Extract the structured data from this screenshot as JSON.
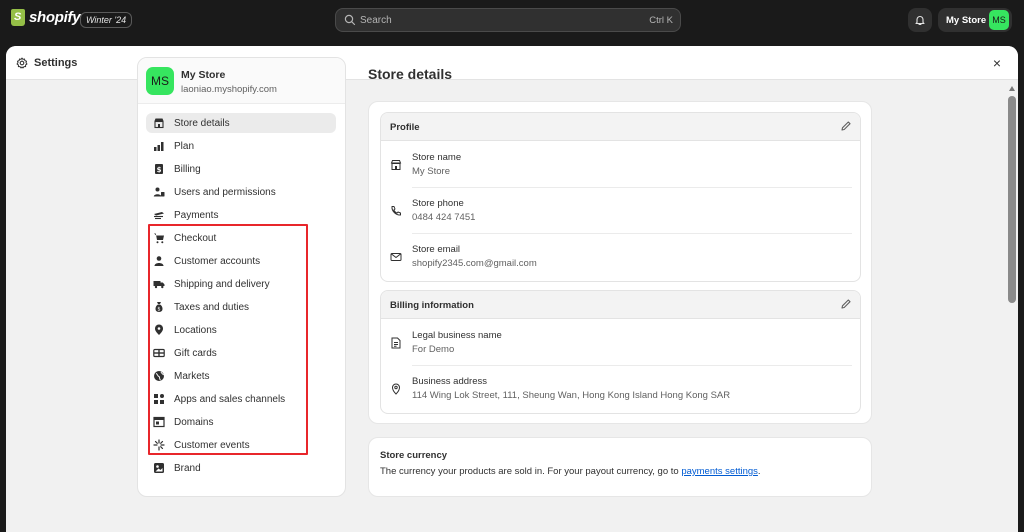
{
  "topbar": {
    "logo_text": "shopify",
    "edition": "Winter '24",
    "search_placeholder": "Search",
    "search_shortcut": "Ctrl K",
    "store_button": "My Store",
    "store_initials": "MS"
  },
  "modal": {
    "title": "Settings",
    "close": "×"
  },
  "sidebar": {
    "store_initials": "MS",
    "store_name": "My Store",
    "store_domain": "laoniao.myshopify.com",
    "items": [
      {
        "label": "Store details",
        "icon": "store-icon",
        "active": true
      },
      {
        "label": "Plan",
        "icon": "plan-icon"
      },
      {
        "label": "Billing",
        "icon": "billing-icon"
      },
      {
        "label": "Users and permissions",
        "icon": "users-icon"
      },
      {
        "label": "Payments",
        "icon": "payments-icon"
      },
      {
        "label": "Checkout",
        "icon": "cart-icon"
      },
      {
        "label": "Customer accounts",
        "icon": "person-icon"
      },
      {
        "label": "Shipping and delivery",
        "icon": "truck-icon"
      },
      {
        "label": "Taxes and duties",
        "icon": "money-bag-icon"
      },
      {
        "label": "Locations",
        "icon": "location-pin-icon"
      },
      {
        "label": "Gift cards",
        "icon": "gift-card-icon"
      },
      {
        "label": "Markets",
        "icon": "globe-icon"
      },
      {
        "label": "Apps and sales channels",
        "icon": "apps-icon"
      },
      {
        "label": "Domains",
        "icon": "domains-icon"
      },
      {
        "label": "Customer events",
        "icon": "sparkle-icon"
      },
      {
        "label": "Brand",
        "icon": "brand-icon"
      }
    ]
  },
  "main": {
    "title": "Store details",
    "profile": {
      "title": "Profile",
      "rows": [
        {
          "label": "Store name",
          "value": "My Store",
          "icon": "store-icon"
        },
        {
          "label": "Store phone",
          "value": "0484 424 7451",
          "icon": "phone-icon"
        },
        {
          "label": "Store email",
          "value": "shopify2345.com@gmail.com",
          "icon": "email-icon"
        }
      ]
    },
    "billing": {
      "title": "Billing information",
      "rows": [
        {
          "label": "Legal business name",
          "value": "For Demo",
          "icon": "document-icon"
        },
        {
          "label": "Business address",
          "value": "114 Wing Lok Street, 111, Sheung Wan, Hong Kong Island Hong Kong SAR",
          "icon": "location-pin-icon"
        }
      ]
    },
    "currency": {
      "title": "Store currency",
      "description": "The currency your products are sold in. For your payout currency, go to",
      "link": "payments settings",
      "suffix": "."
    }
  },
  "colors": {
    "accent_green": "#36e55f",
    "highlight_red": "#e8262b",
    "link_blue": "#005bd3"
  }
}
